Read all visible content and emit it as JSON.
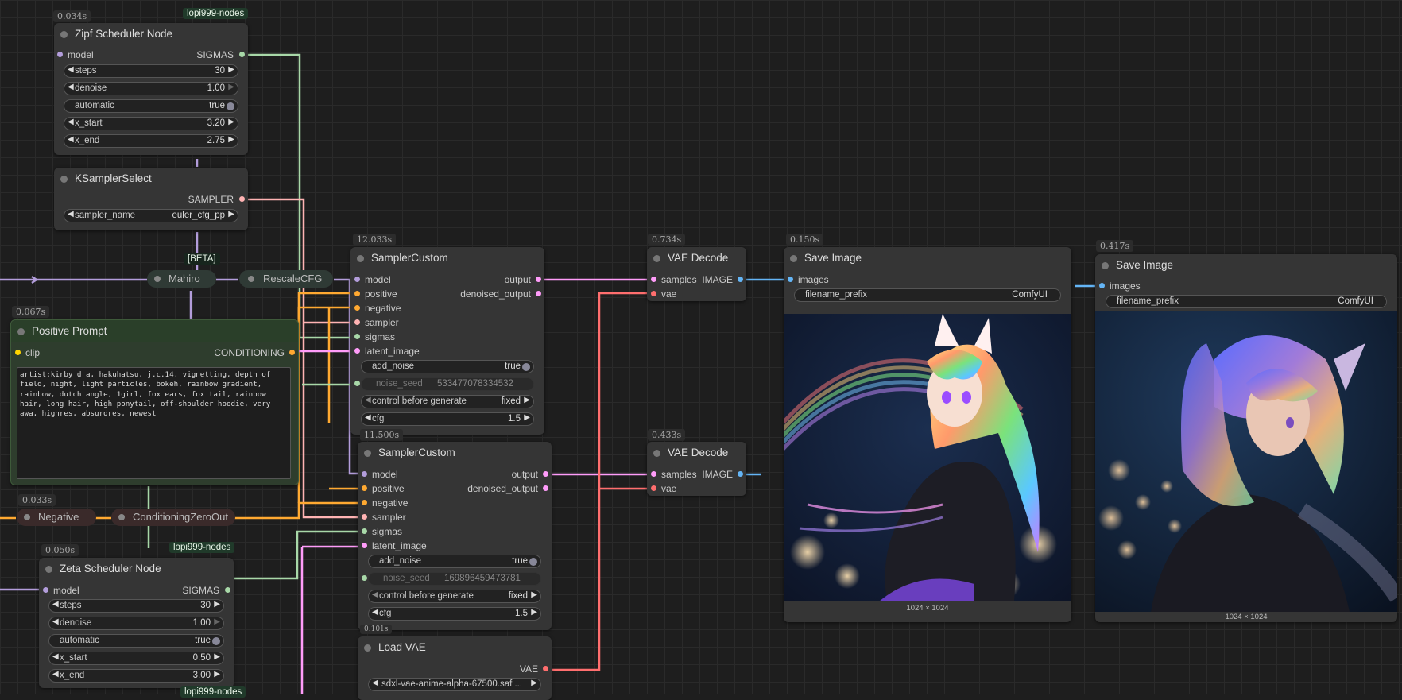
{
  "colors": {
    "canvas_bg": "#1e1e1e",
    "node_bg": "#353535",
    "green_node_bg": "#2e3d2d",
    "link_model": "#b39ddb",
    "link_sigmas": "#a8d8a8",
    "link_sampler": "#ffb3b3",
    "link_conditioning": "#ffa931",
    "link_latent": "#ff9cf9",
    "link_image": "#64b5f6",
    "link_vae": "#ff6e6e",
    "link_noise": "#b0e0b0"
  },
  "zipf": {
    "time": "0.034s",
    "badge": "lopi999-nodes",
    "title": "Zipf Scheduler Node",
    "in_model": "model",
    "out_sigmas": "SIGMAS",
    "steps_label": "steps",
    "steps_value": "30",
    "denoise_label": "denoise",
    "denoise_value": "1.00",
    "automatic_label": "automatic",
    "automatic_value": "true",
    "xstart_label": "x_start",
    "xstart_value": "3.20",
    "xend_label": "x_end",
    "xend_value": "2.75"
  },
  "ksampler_select": {
    "title": "KSamplerSelect",
    "out_sampler": "SAMPLER",
    "sampler_label": "sampler_name",
    "sampler_value": "euler_cfg_pp"
  },
  "beta_badge": "[BETA]",
  "mahiro": "Mahiro",
  "rescalecfg": "RescaleCFG",
  "positive_prompt": {
    "time": "0.067s",
    "title": "Positive Prompt",
    "in_clip": "clip",
    "out": "CONDITIONING",
    "text": "artist:kirby d a, hakuhatsu, j.c.14, vignetting, depth of field, night, light particles, bokeh, rainbow gradient, rainbow, dutch angle, 1girl, fox ears, fox tail, rainbow hair, long hair, high ponytail, off-shoulder hoodie, very awa, highres, absurdres, newest"
  },
  "negative": {
    "time": "0.033s",
    "label": "Negative"
  },
  "cond_zero": "ConditioningZeroOut",
  "zeta": {
    "time": "0.050s",
    "badge": "lopi999-nodes",
    "badge2": "lopi999-nodes",
    "title": "Zeta Scheduler Node",
    "in_model": "model",
    "out_sigmas": "SIGMAS",
    "steps_label": "steps",
    "steps_value": "30",
    "denoise_label": "denoise",
    "denoise_value": "1.00",
    "automatic_label": "automatic",
    "automatic_value": "true",
    "xstart_label": "x_start",
    "xstart_value": "0.50",
    "xend_label": "x_end",
    "xend_value": "3.00"
  },
  "sampler1": {
    "time": "12.033s",
    "title": "SamplerCustom",
    "in_model": "model",
    "in_positive": "positive",
    "in_negative": "negative",
    "in_sampler": "sampler",
    "in_sigmas": "sigmas",
    "in_latent": "latent_image",
    "out_output": "output",
    "out_denoised": "denoised_output",
    "add_noise_label": "add_noise",
    "add_noise_value": "true",
    "seed_label": "noise_seed",
    "seed_value": "533477078334532",
    "control_label": "control before generate",
    "control_value": "fixed",
    "cfg_label": "cfg",
    "cfg_value": "1.5"
  },
  "sampler2": {
    "time": "11.500s",
    "title": "SamplerCustom",
    "in_model": "model",
    "in_positive": "positive",
    "in_negative": "negative",
    "in_sampler": "sampler",
    "in_sigmas": "sigmas",
    "in_latent": "latent_image",
    "out_output": "output",
    "out_denoised": "denoised_output",
    "add_noise_label": "add_noise",
    "add_noise_value": "true",
    "seed_label": "noise_seed",
    "seed_value": "169896459473781",
    "control_label": "control before generate",
    "control_value": "fixed",
    "cfg_label": "cfg",
    "cfg_value": "1.5"
  },
  "load_vae": {
    "time": "0.101s",
    "title": "Load VAE",
    "out_vae": "VAE",
    "vae_value": "sdxl-vae-anime-alpha-67500.saf ..."
  },
  "vae_decode1": {
    "time": "0.734s",
    "title": "VAE Decode",
    "in_samples": "samples",
    "in_vae": "vae",
    "out_image": "IMAGE"
  },
  "vae_decode2": {
    "time": "0.433s",
    "title": "VAE Decode",
    "in_samples": "samples",
    "in_vae": "vae",
    "out_image": "IMAGE"
  },
  "save1": {
    "time": "0.150s",
    "title": "Save Image",
    "in_images": "images",
    "prefix_label": "filename_prefix",
    "prefix_value": "ComfyUI",
    "size": "1024 × 1024"
  },
  "save2": {
    "time": "0.417s",
    "title": "Save Image",
    "in_images": "images",
    "prefix_label": "filename_prefix",
    "prefix_value": "ComfyUI",
    "size": "1024 × 1024"
  }
}
